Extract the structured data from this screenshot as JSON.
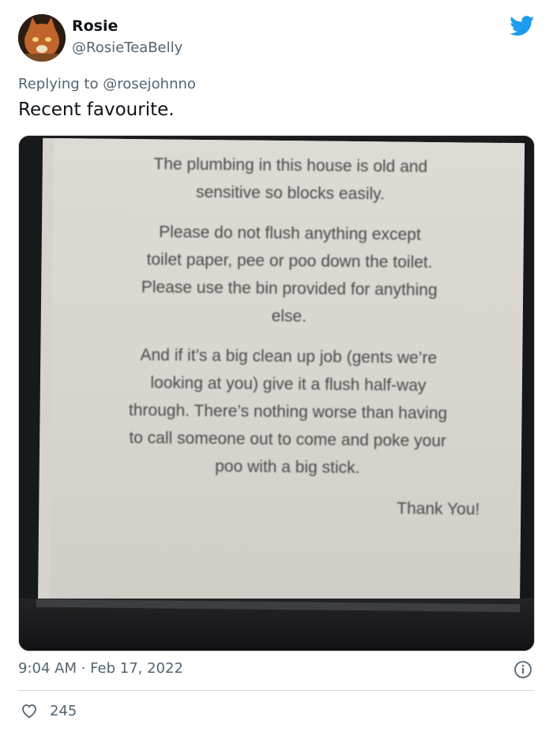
{
  "author": {
    "display_name": "Rosie",
    "handle": "@RosieTeaBelly"
  },
  "reply": {
    "prefix": "Replying to ",
    "mention": "@rosejohnno"
  },
  "tweet_text": "Recent favourite.",
  "photo": {
    "sign_paragraphs": [
      "The plumbing in this house is old and sensitive so blocks easily.",
      "Please do not flush anything except toilet paper, pee or poo down the toilet. Please use the bin provided for anything else.",
      "And if it’s a big clean up job (gents we’re looking at you) give it a flush half-way through. There’s nothing worse than having to call someone out to come and poke your poo with a big stick."
    ],
    "sign_signoff": "Thank You!"
  },
  "meta": {
    "timestamp": "9:04 AM · Feb 17, 2022"
  },
  "engagement": {
    "likes": "245"
  },
  "icons": {
    "brand": "twitter-bird-icon",
    "info": "info-icon",
    "like": "heart-icon"
  },
  "colors": {
    "twitter_blue": "#1d9bf0",
    "secondary_text": "#536471",
    "primary_text": "#0f1419"
  }
}
